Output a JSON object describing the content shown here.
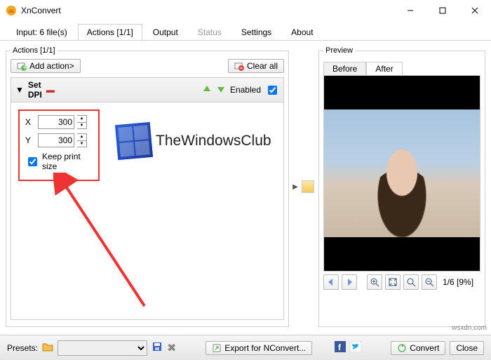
{
  "window": {
    "title": "XnConvert"
  },
  "tabs": {
    "input": "Input: 6 file(s)",
    "actions": "Actions [1/1]",
    "output": "Output",
    "status": "Status",
    "settings": "Settings",
    "about": "About"
  },
  "actions_panel": {
    "legend": "Actions [1/1]",
    "add_action": "Add action>",
    "clear_all": "Clear all",
    "action_title": "Set DPI",
    "enabled_label": "Enabled",
    "x_label": "X",
    "y_label": "Y",
    "x_val": "300",
    "y_val": "300",
    "keep_print": "Keep print size"
  },
  "wm_text": "TheWindowsClub",
  "preview": {
    "legend": "Preview",
    "before": "Before",
    "after": "After",
    "counter": "1/6 [9%]"
  },
  "footer": {
    "presets_label": "Presets:",
    "export": "Export for NConvert...",
    "convert": "Convert",
    "close": "Close"
  },
  "watermark": "wsxdn.com"
}
